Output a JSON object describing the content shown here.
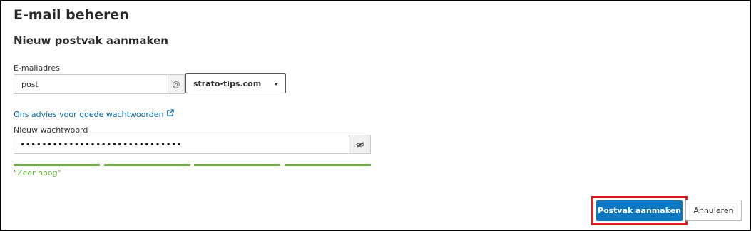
{
  "header": {
    "title": "E-mail beheren"
  },
  "form": {
    "section_title": "Nieuw postvak aanmaken",
    "email_label": "E-mailadres",
    "email_value": "post",
    "at_symbol": "@",
    "domain_selected": "strato-tips.com",
    "advice_link": "Ons advies voor goede wachtwoorden",
    "password_label": "Nieuw wachtwoord",
    "password_mask": "••••••••••••••••••••••••••••••",
    "strength": {
      "text": "\"Zeer hoog\"",
      "segments_filled": 4,
      "segments_total": 4,
      "color": "#6cb23f"
    }
  },
  "actions": {
    "create_label": "Postvak aanmaken",
    "cancel_label": "Annuleren"
  },
  "colors": {
    "primary": "#0e77c2",
    "link": "#0b6aa6",
    "highlight": "#e01b22"
  },
  "icons": {
    "external": "external-link-icon",
    "eye": "eye-slash-icon",
    "dropdown": "chevron-down-icon"
  }
}
